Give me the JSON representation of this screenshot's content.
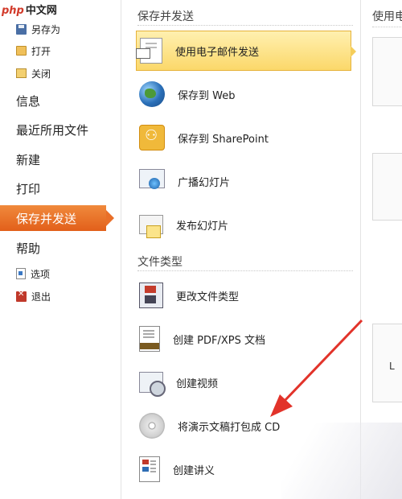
{
  "watermark": {
    "brand": "php",
    "suffix": "中文网"
  },
  "nav": {
    "save_as": "另存为",
    "open": "打开",
    "close": "关闭",
    "info": "信息",
    "recent": "最近所用文件",
    "new": "新建",
    "print": "打印",
    "save_send": "保存并发送",
    "help": "帮助",
    "options": "选项",
    "exit": "退出"
  },
  "save_send_section": {
    "title": "保存并发送",
    "items": [
      {
        "label": "使用电子邮件发送",
        "icon": "email-icon",
        "selected": true
      },
      {
        "label": "保存到 Web",
        "icon": "globe-icon"
      },
      {
        "label": "保存到 SharePoint",
        "icon": "sharepoint-icon"
      },
      {
        "label": "广播幻灯片",
        "icon": "broadcast-icon"
      },
      {
        "label": "发布幻灯片",
        "icon": "publish-slides-icon"
      }
    ]
  },
  "file_types_section": {
    "title": "文件类型",
    "items": [
      {
        "label": "更改文件类型",
        "icon": "change-file-type-icon"
      },
      {
        "label": "创建 PDF/XPS 文档",
        "icon": "pdf-xps-icon"
      },
      {
        "label": "创建视频",
        "icon": "video-icon"
      },
      {
        "label": "将演示文稿打包成 CD",
        "icon": "cd-icon"
      },
      {
        "label": "创建讲义",
        "icon": "handout-icon"
      }
    ]
  },
  "right_panel": {
    "title": "使用电",
    "partial_text": "L"
  },
  "colors": {
    "active_nav": "#e96f28",
    "selected_item": "#fbd86a",
    "arrow": "#e2332a"
  }
}
